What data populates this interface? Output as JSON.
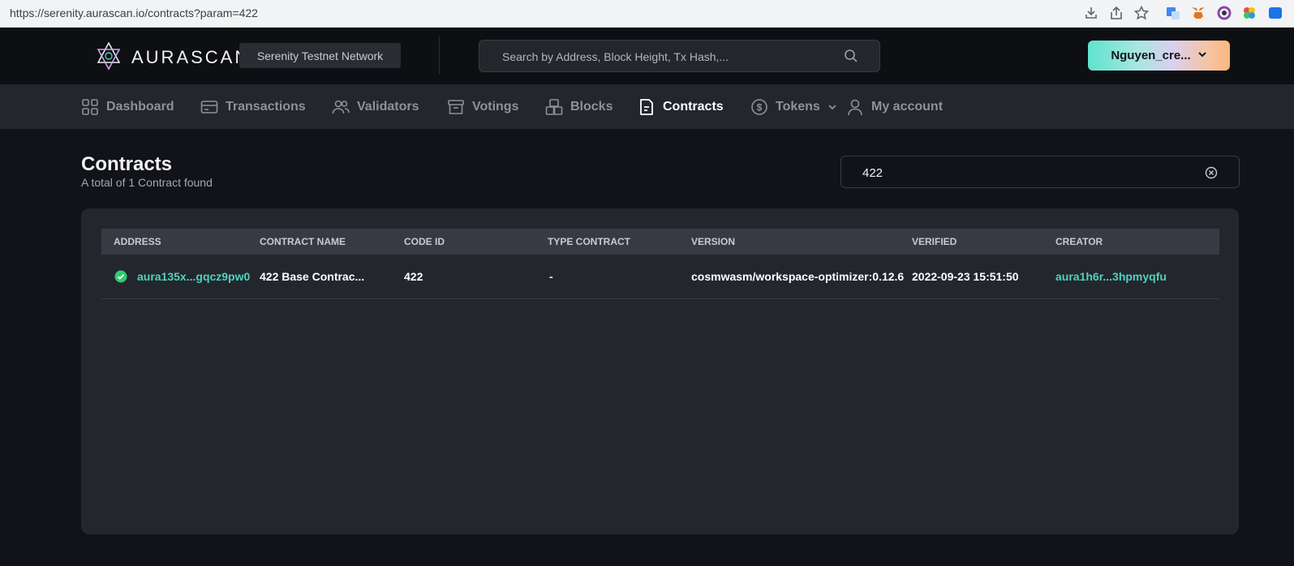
{
  "browser": {
    "url": "https://serenity.aurascan.io/contracts?param=422"
  },
  "header": {
    "logo_text": "AURASCAN",
    "network_label": "Serenity Testnet Network",
    "search_placeholder": "Search by Address, Block Height, Tx Hash,...",
    "user_label": "Nguyen_cre..."
  },
  "nav": {
    "items": [
      {
        "label": "Dashboard",
        "icon": "grid-icon"
      },
      {
        "label": "Transactions",
        "icon": "card-icon"
      },
      {
        "label": "Validators",
        "icon": "users-icon"
      },
      {
        "label": "Votings",
        "icon": "archive-icon"
      },
      {
        "label": "Blocks",
        "icon": "blocks-icon"
      },
      {
        "label": "Contracts",
        "icon": "document-icon",
        "active": true
      },
      {
        "label": "Tokens",
        "icon": "coin-icon"
      },
      {
        "label": "My account",
        "icon": "user-icon"
      }
    ]
  },
  "page": {
    "title": "Contracts",
    "subtitle": "A total of 1 Contract found",
    "filter_value": "422"
  },
  "table": {
    "columns": [
      "ADDRESS",
      "CONTRACT NAME",
      "CODE ID",
      "TYPE CONTRACT",
      "VERSION",
      "VERIFIED",
      "CREATOR"
    ],
    "rows": [
      {
        "address": "aura135x...gqcz9pw0",
        "contract_name": "422 Base Contrac...",
        "code_id": "422",
        "type_contract": "-",
        "version": "cosmwasm/workspace-optimizer:0.12.6",
        "verified": "2022-09-23 15:51:50",
        "creator": "aura1h6r...3hpmyqfu"
      }
    ]
  },
  "colors": {
    "accent": "#4fd2c0",
    "background": "#121318",
    "card": "#24262d",
    "verified": "#2ecc71"
  }
}
